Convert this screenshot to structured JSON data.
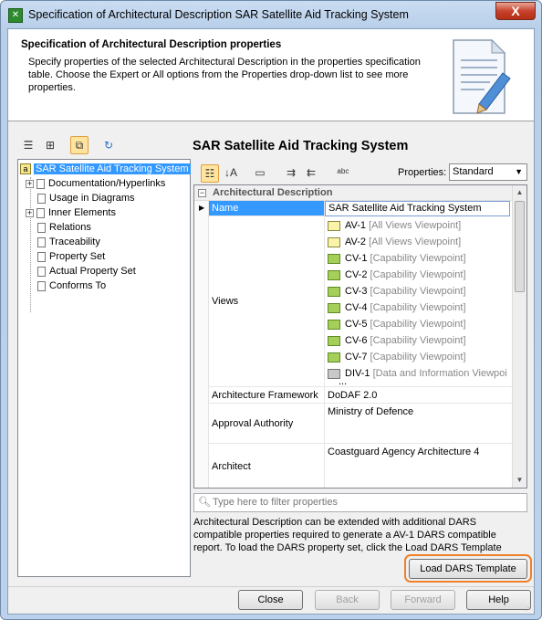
{
  "window": {
    "title": "Specification of Architectural Description SAR Satellite Aid Tracking System",
    "close_label": "X"
  },
  "header": {
    "title": "Specification of Architectural Description properties",
    "description": "Specify properties of the selected Architectural Description in the properties specification table. Choose the Expert or All options from the Properties drop-down list to see more properties."
  },
  "tree": {
    "root": "SAR Satellite Aid Tracking System",
    "items": [
      {
        "label": "Documentation/Hyperlinks",
        "expandable": true
      },
      {
        "label": "Usage in Diagrams",
        "expandable": false
      },
      {
        "label": "Inner Elements",
        "expandable": true
      },
      {
        "label": "Relations",
        "expandable": false
      },
      {
        "label": "Traceability",
        "expandable": false
      },
      {
        "label": "Property Set",
        "expandable": false
      },
      {
        "label": "Actual Property Set",
        "expandable": false
      },
      {
        "label": "Conforms To",
        "expandable": false
      }
    ]
  },
  "spec": {
    "title": "SAR Satellite Aid Tracking System",
    "properties_label": "Properties:",
    "properties_value": "Standard",
    "group": "Architectural Description",
    "rows": {
      "name_label": "Name",
      "name_value": "SAR Satellite Aid Tracking System",
      "views_label": "Views",
      "framework_label": "Architecture Framework",
      "framework_value": "DoDAF 2.0",
      "approval_label": "Approval Authority",
      "approval_value": "Ministry of Defence",
      "architect_label": "Architect",
      "architect_value": "Coastguard Agency Architecture 4"
    },
    "views": [
      {
        "name": "AV-1",
        "viewpoint": "[All Views Viewpoint]",
        "icon": "yellow"
      },
      {
        "name": "AV-2",
        "viewpoint": "[All Views Viewpoint]",
        "icon": "yellow"
      },
      {
        "name": "CV-1",
        "viewpoint": "[Capability Viewpoint]",
        "icon": "green"
      },
      {
        "name": "CV-2",
        "viewpoint": "[Capability Viewpoint]",
        "icon": "green"
      },
      {
        "name": "CV-3",
        "viewpoint": "[Capability Viewpoint]",
        "icon": "green"
      },
      {
        "name": "CV-4",
        "viewpoint": "[Capability Viewpoint]",
        "icon": "green"
      },
      {
        "name": "CV-5",
        "viewpoint": "[Capability Viewpoint]",
        "icon": "green"
      },
      {
        "name": "CV-6",
        "viewpoint": "[Capability Viewpoint]",
        "icon": "green"
      },
      {
        "name": "CV-7",
        "viewpoint": "[Capability Viewpoint]",
        "icon": "green"
      },
      {
        "name": "DIV-1",
        "viewpoint": "[Data and Information Viewpoi",
        "icon": "gray"
      }
    ],
    "views_more": "...",
    "filter_placeholder": "Type here to filter properties",
    "info_text": "Architectural Description can be extended with additional DARS compatible properties required to generate a AV-1 DARS compatible report. To load the DARS property set, click the Load DARS Template button.",
    "load_button": "Load DARS Template"
  },
  "buttons": {
    "close": "Close",
    "back": "Back",
    "forward": "Forward",
    "help": "Help"
  },
  "colors": {
    "selection": "#3399ff",
    "highlight_ring": "#f07f29"
  }
}
